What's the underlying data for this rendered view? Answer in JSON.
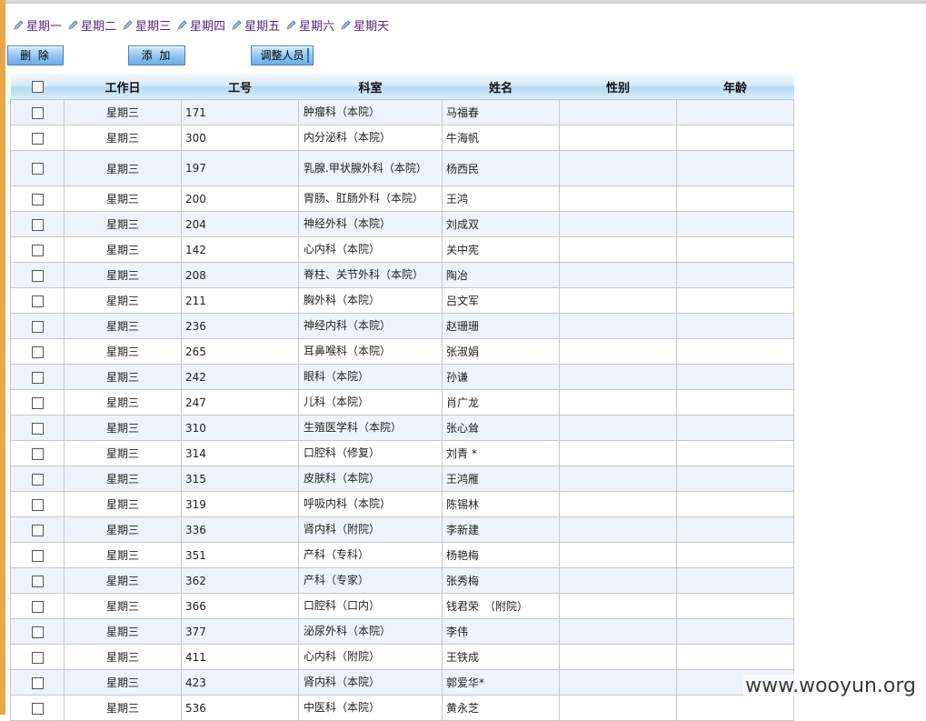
{
  "day_tabs": [
    "星期一",
    "星期二",
    "星期三",
    "星期四",
    "星期五",
    "星期六",
    "星期天"
  ],
  "toolbar": {
    "delete_label": "删 除",
    "add_label": "添 加",
    "adjust_label": "调整人员"
  },
  "table": {
    "headers": [
      "",
      "工作日",
      "工号",
      "科室",
      "姓名",
      "性别",
      "年龄"
    ],
    "rows": [
      {
        "day": "星期三",
        "id": "171",
        "dept": "肿瘤科（本院）",
        "name": "马福春"
      },
      {
        "day": "星期三",
        "id": "300",
        "dept": "内分泌科（本院）",
        "name": "牛海帆"
      },
      {
        "day": "星期三",
        "id": "197",
        "dept": "乳腺.甲状腺外科（本院）",
        "name": "杨西民"
      },
      {
        "day": "星期三",
        "id": "200",
        "dept": "胃肠、肛肠外科（本院）",
        "name": "王鸿"
      },
      {
        "day": "星期三",
        "id": "204",
        "dept": "神经外科（本院）",
        "name": "刘成双"
      },
      {
        "day": "星期三",
        "id": "142",
        "dept": "心内科（本院）",
        "name": "关中宪"
      },
      {
        "day": "星期三",
        "id": "208",
        "dept": "脊柱、关节外科（本院）",
        "name": "陶冶"
      },
      {
        "day": "星期三",
        "id": "211",
        "dept": "胸外科（本院）",
        "name": "吕文军"
      },
      {
        "day": "星期三",
        "id": "236",
        "dept": "神经内科（本院）",
        "name": "赵珊珊"
      },
      {
        "day": "星期三",
        "id": "265",
        "dept": "耳鼻喉科（本院）",
        "name": "张淑娟"
      },
      {
        "day": "星期三",
        "id": "242",
        "dept": "眼科（本院）",
        "name": "孙谦"
      },
      {
        "day": "星期三",
        "id": "247",
        "dept": "儿科（本院）",
        "name": "肖广龙"
      },
      {
        "day": "星期三",
        "id": "310",
        "dept": "生殖医学科（本院）",
        "name": "张心耸"
      },
      {
        "day": "星期三",
        "id": "314",
        "dept": "口腔科（修复）",
        "name": "刘青 *"
      },
      {
        "day": "星期三",
        "id": "315",
        "dept": "皮肤科（本院）",
        "name": "王鸿雁"
      },
      {
        "day": "星期三",
        "id": "319",
        "dept": "呼吸内科（本院）",
        "name": "陈锡林"
      },
      {
        "day": "星期三",
        "id": "336",
        "dept": "肾内科（附院）",
        "name": "李新建"
      },
      {
        "day": "星期三",
        "id": "351",
        "dept": "产科（专科）",
        "name": "杨艳梅"
      },
      {
        "day": "星期三",
        "id": "362",
        "dept": "产科（专家）",
        "name": "张秀梅"
      },
      {
        "day": "星期三",
        "id": "366",
        "dept": "口腔科（口内）",
        "name": "钱君荣　（附院）"
      },
      {
        "day": "星期三",
        "id": "377",
        "dept": "泌尿外科（本院）",
        "name": "李伟"
      },
      {
        "day": "星期三",
        "id": "411",
        "dept": "心内科（附院）",
        "name": "王铁成"
      },
      {
        "day": "星期三",
        "id": "423",
        "dept": "肾内科（本院）",
        "name": "郭爱华*"
      },
      {
        "day": "星期三",
        "id": "536",
        "dept": "中医科（本院）",
        "name": "黄永芝"
      }
    ]
  },
  "watermark": "www.wooyun.org"
}
